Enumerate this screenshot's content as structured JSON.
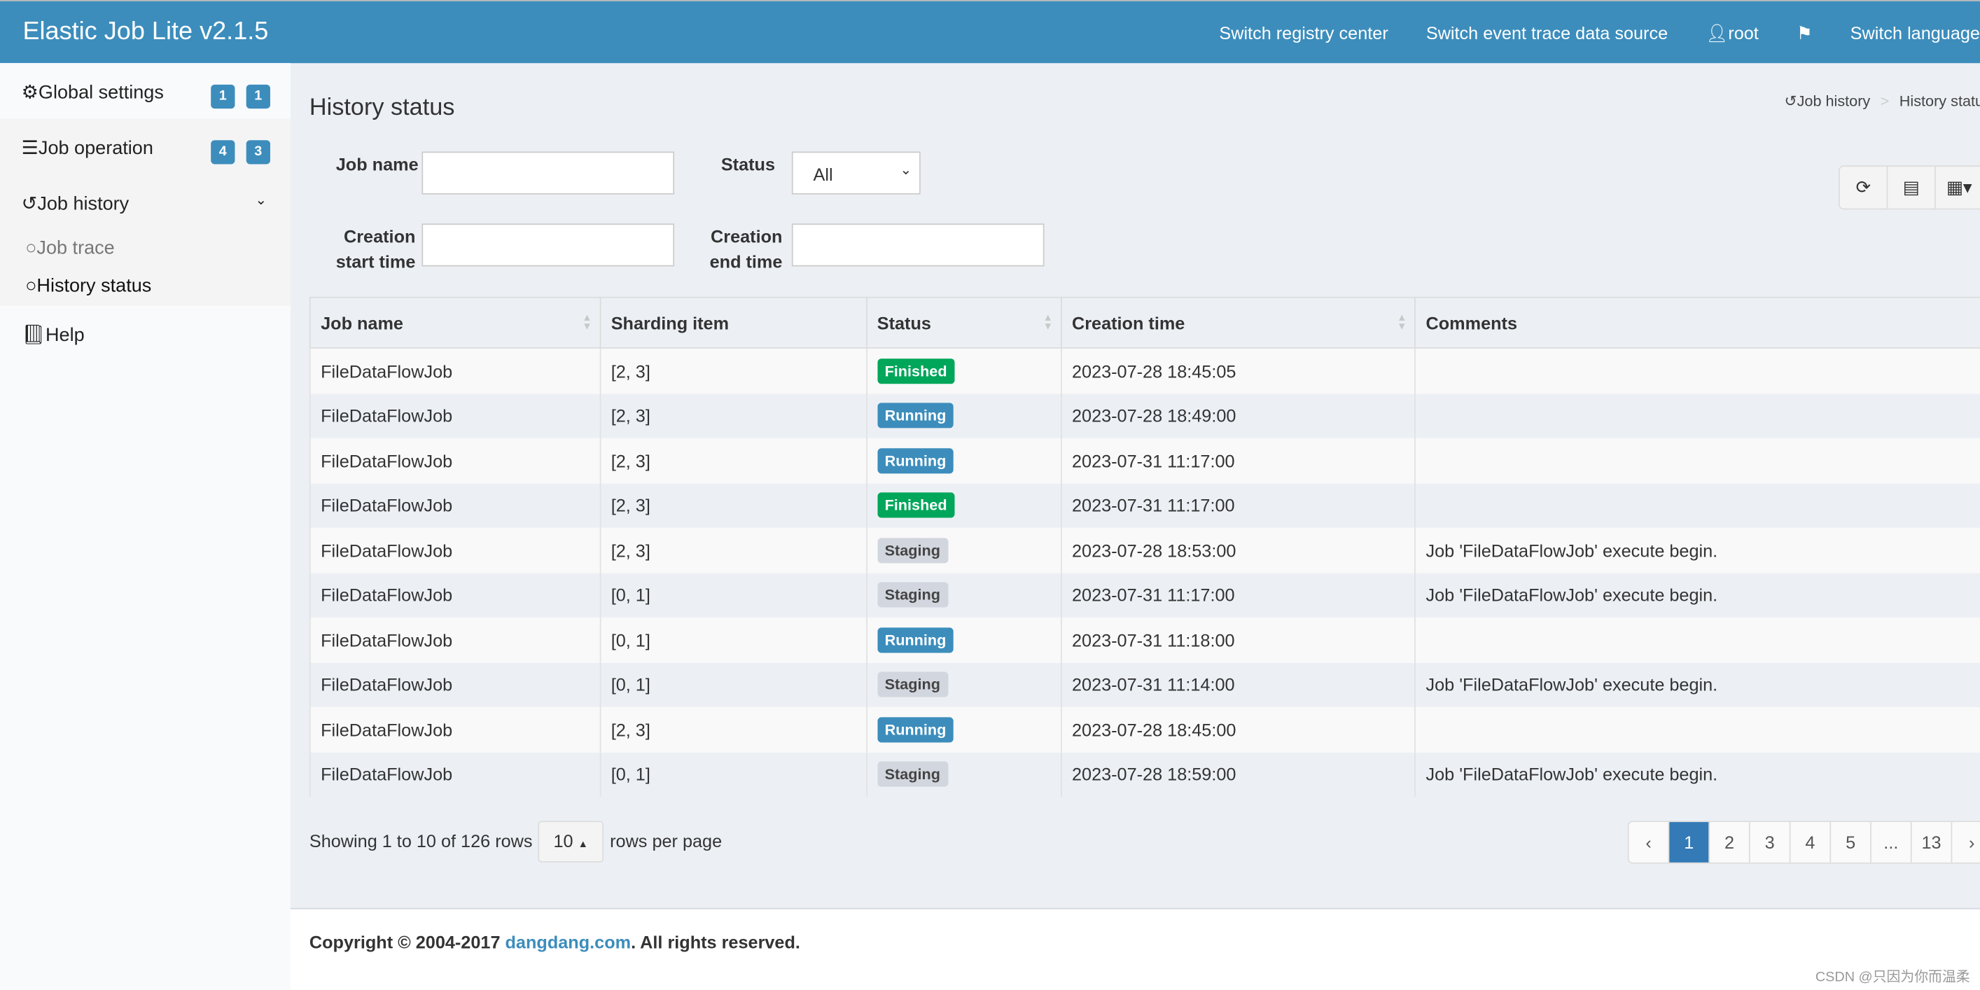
{
  "header": {
    "brand": "Elastic Job Lite v2.1.5",
    "nav": [
      "Switch registry center",
      "Switch event trace data source",
      "root",
      "Switch language"
    ]
  },
  "sidebar": {
    "items": [
      {
        "label": "Global settings",
        "badges": [
          "1",
          "1"
        ]
      },
      {
        "label": "Job operation",
        "badges": [
          "4",
          "3"
        ]
      },
      {
        "label": "Job history"
      },
      {
        "label": "Help"
      }
    ],
    "sub": [
      {
        "label": "Job trace"
      },
      {
        "label": "History status"
      }
    ]
  },
  "page": {
    "title": "History status",
    "breadcrumb": [
      "Job history",
      "History status"
    ]
  },
  "filters": {
    "job_name_label": "Job name",
    "status_label": "Status",
    "status_value": "All",
    "start_label_1": "Creation",
    "start_label_2": "start time",
    "end_label_1": "Creation",
    "end_label_2": "end time"
  },
  "table": {
    "columns": [
      "Job name",
      "Sharding item",
      "Status",
      "Creation time",
      "Comments"
    ],
    "rows": [
      [
        "FileDataFlowJob",
        "[2, 3]",
        "Finished",
        "2023-07-28 18:45:05",
        ""
      ],
      [
        "FileDataFlowJob",
        "[2, 3]",
        "Running",
        "2023-07-28 18:49:00",
        ""
      ],
      [
        "FileDataFlowJob",
        "[2, 3]",
        "Running",
        "2023-07-31 11:17:00",
        ""
      ],
      [
        "FileDataFlowJob",
        "[2, 3]",
        "Finished",
        "2023-07-31 11:17:00",
        ""
      ],
      [
        "FileDataFlowJob",
        "[2, 3]",
        "Staging",
        "2023-07-28 18:53:00",
        "Job 'FileDataFlowJob' execute begin."
      ],
      [
        "FileDataFlowJob",
        "[0, 1]",
        "Staging",
        "2023-07-31 11:17:00",
        "Job 'FileDataFlowJob' execute begin."
      ],
      [
        "FileDataFlowJob",
        "[0, 1]",
        "Running",
        "2023-07-31 11:18:00",
        ""
      ],
      [
        "FileDataFlowJob",
        "[0, 1]",
        "Staging",
        "2023-07-31 11:14:00",
        "Job 'FileDataFlowJob' execute begin."
      ],
      [
        "FileDataFlowJob",
        "[2, 3]",
        "Running",
        "2023-07-28 18:45:00",
        ""
      ],
      [
        "FileDataFlowJob",
        "[0, 1]",
        "Staging",
        "2023-07-28 18:59:00",
        "Job 'FileDataFlowJob' execute begin."
      ]
    ]
  },
  "status_colors": {
    "Finished": "#00a65a",
    "Running": "#3c8dbc",
    "Staging": "#d2d6de"
  },
  "pagination": {
    "showing": "Showing 1 to 10 of 126 rows",
    "page_size": "10",
    "rows_per_page": "rows per page",
    "prev": "‹",
    "pages": [
      "1",
      "2",
      "3",
      "4",
      "5",
      "...",
      "13"
    ],
    "next": "›",
    "active": "1"
  },
  "footer": {
    "prefix": "Copyright © 2004-2017 ",
    "link": "dangdang.com",
    "suffix": ". All rights reserved."
  },
  "watermark": "CSDN @只因为你而温柔"
}
